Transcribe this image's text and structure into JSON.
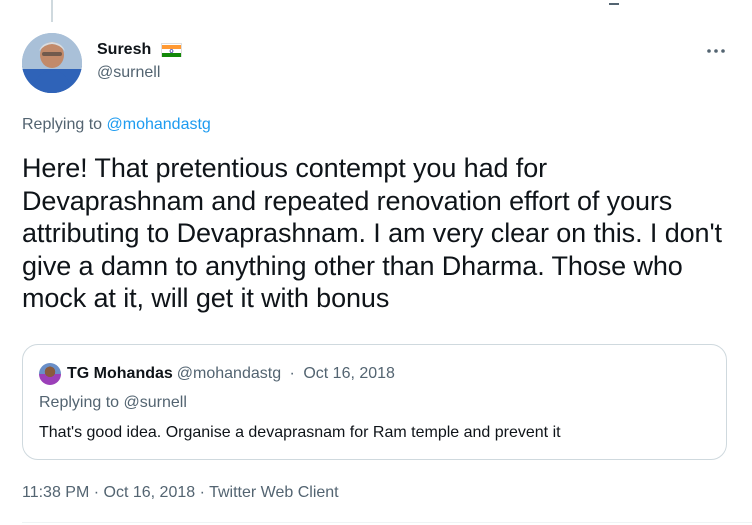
{
  "tweet": {
    "author": {
      "display_name": "Suresh",
      "flag_icon": "india-flag-icon",
      "handle": "@surnell"
    },
    "more_icon": "ellipsis-icon",
    "replying_prefix": "Replying to",
    "replying_handle": "@mohandastg",
    "text": "Here! That pretentious contempt you had for Devaprashnam and repeated renovation effort of yours attributing to Devaprashnam. I am very clear on this. I don't give a damn to anything other than Dharma. Those who mock at it, will get it with bonus",
    "time": "11:38 PM",
    "date": "Oct 16, 2018",
    "source": "Twitter Web Client",
    "separator": "·"
  },
  "quote": {
    "display_name": "TG Mohandas",
    "handle": "@mohandastg",
    "separator": "·",
    "date": "Oct 16, 2018",
    "replying": "Replying to @surnell",
    "text": "That's good idea. Organise a devaprasnam for Ram temple and prevent it"
  },
  "colors": {
    "text_primary": "#0f1419",
    "text_secondary": "#536471",
    "link": "#1d9bf0",
    "border": "#cfd9de"
  }
}
